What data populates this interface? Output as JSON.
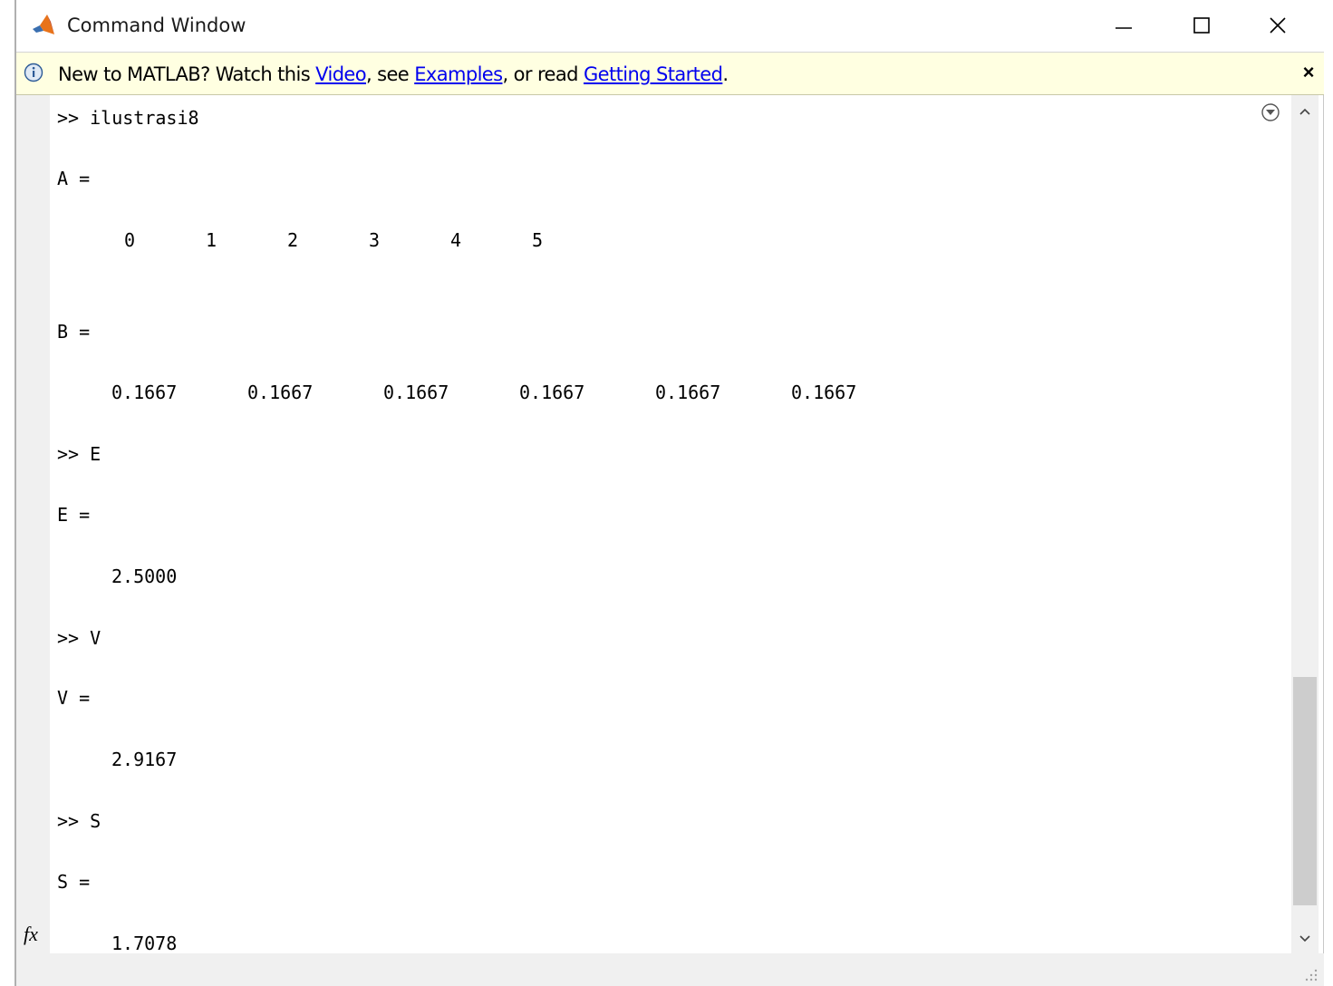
{
  "window": {
    "title": "Command Window"
  },
  "titlebar": {
    "icons": [
      "matlab-logo-icon",
      "minimize-icon",
      "maximize-icon",
      "close-icon"
    ]
  },
  "infobar": {
    "prefix": "New to MATLAB? Watch this ",
    "video_link": "Video",
    "mid1": ", see ",
    "examples_link": "Examples",
    "mid2": ", or read ",
    "getting_started_link": "Getting Started",
    "suffix": ".",
    "close_label": "×",
    "icon": "info-icon"
  },
  "console": {
    "cmd1": ">> ilustrasi8",
    "a_label": "A =",
    "a_values": [
      "0",
      "1",
      "2",
      "3",
      "4",
      "5"
    ],
    "b_label": "B =",
    "b_values": [
      "0.1667",
      "0.1667",
      "0.1667",
      "0.1667",
      "0.1667",
      "0.1667"
    ],
    "cmd2": ">> E",
    "e_label": "E =",
    "e_value": "2.5000",
    "cmd3": ">> V",
    "v_label": "V =",
    "v_value": "2.9167",
    "cmd4": ">> S",
    "s_label": "S =",
    "s_value": "1.7078"
  },
  "prompt": {
    "fx_label": "fx"
  },
  "colors": {
    "infobar_bg": "#ffffe1",
    "link": "#0000ee",
    "gutter": "#f0f0f0",
    "scroll_thumb": "#cdcdcd"
  }
}
